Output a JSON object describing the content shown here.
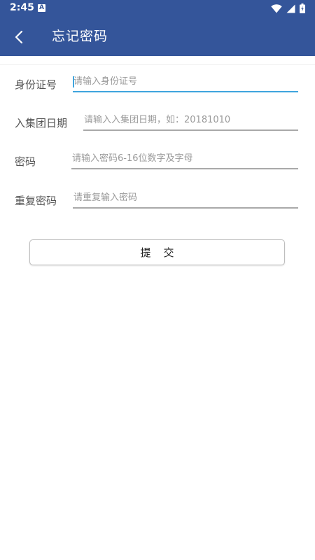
{
  "status_bar": {
    "time": "2:45",
    "notification_icon": "A"
  },
  "app_bar": {
    "back_icon": "chevron-left-icon",
    "title": "忘记密码"
  },
  "form": {
    "fields": [
      {
        "label": "身份证号",
        "placeholder": "请输入身份证号",
        "value": ""
      },
      {
        "label": "入集团日期",
        "placeholder": "请输入入集团日期，如：20181010",
        "value": ""
      },
      {
        "label": "密码",
        "placeholder": "请输入密码6-16位数字及字母",
        "value": ""
      },
      {
        "label": "重复密码",
        "placeholder": "请重复输入密码",
        "value": ""
      }
    ],
    "submit_label": "提交"
  },
  "colors": {
    "primary": "#34559a",
    "focus_underline": "#3fa5de",
    "underline": "#a9a9a9"
  }
}
